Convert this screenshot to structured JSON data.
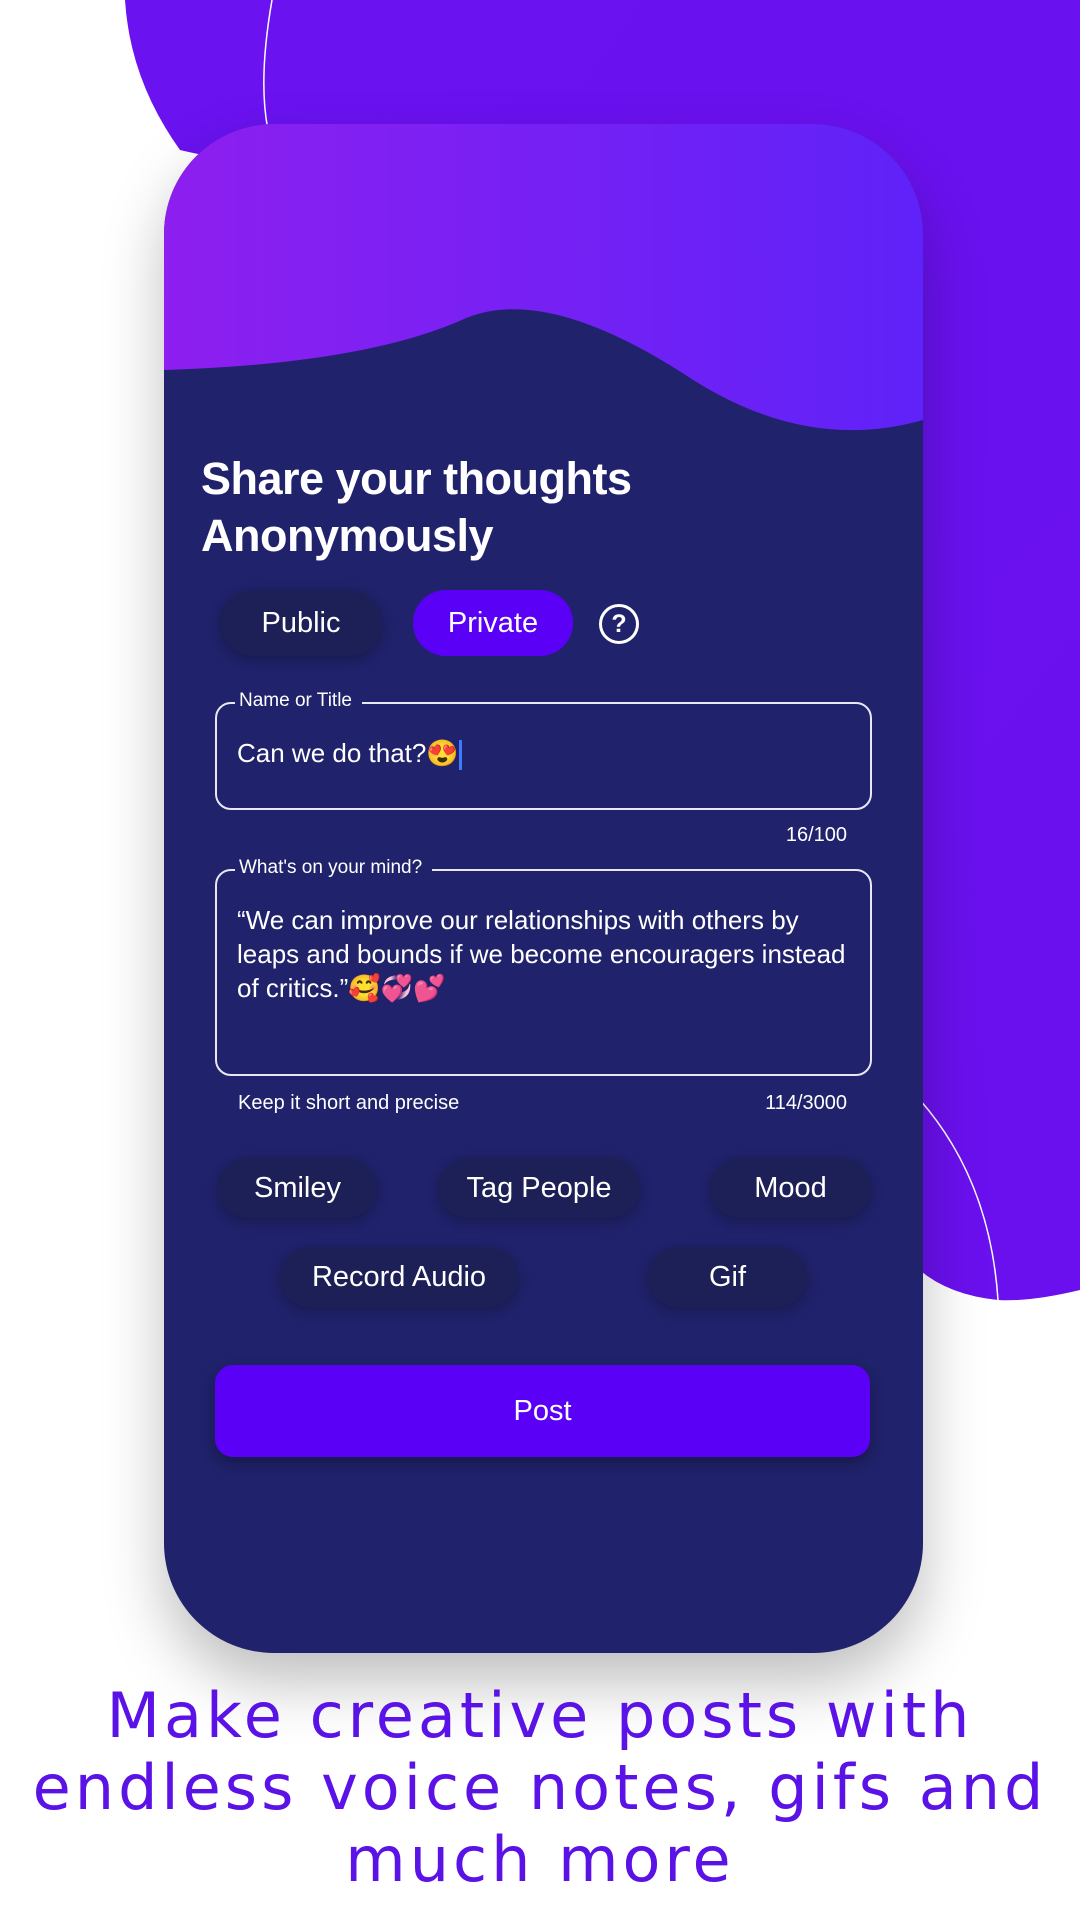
{
  "colors": {
    "accent": "#5b00f7",
    "panel": "#20226b",
    "chip": "#1d1f57",
    "tagline": "#5a12e6"
  },
  "screen": {
    "title_line1": "Share your thoughts",
    "title_line2": "Anonymously",
    "visibility": {
      "options": [
        "Public",
        "Private"
      ],
      "selected": "Private",
      "help_icon": "question-circle-icon",
      "help_glyph": "?"
    },
    "name_field": {
      "label": "Name or Title",
      "value": "Can we do that?😍",
      "counter": "16/100"
    },
    "mind_field": {
      "label": "What's on your mind?",
      "value": "“We can improve our relationships with others by leaps and bounds if we become encouragers instead of critics.”🥰💞💕",
      "helper": "Keep it short and precise",
      "counter": "114/3000"
    },
    "chips": [
      "Smiley",
      "Tag People",
      "Mood",
      "Record Audio",
      "Gif"
    ],
    "post_label": "Post"
  },
  "tagline": "Make creative posts with endless voice notes, gifs and much more"
}
